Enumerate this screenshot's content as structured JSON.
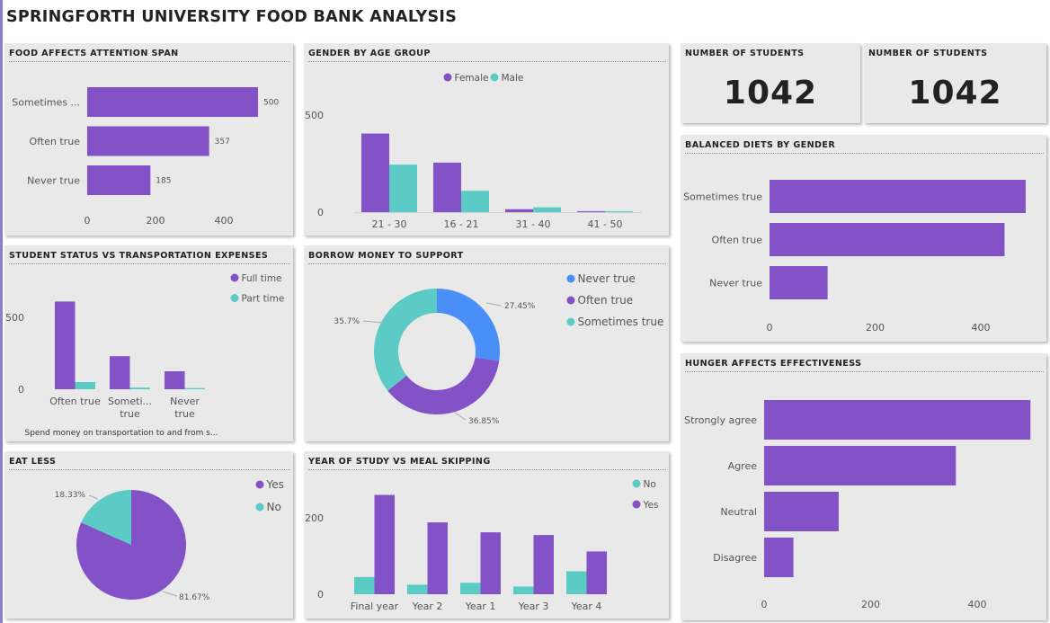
{
  "page": {
    "title": "SPRINGFORTH UNIVERSITY FOOD BANK ANALYSIS"
  },
  "colors": {
    "purple": "#8352c7",
    "teal": "#5ccbc6",
    "blue": "#4a8ef8",
    "text": "#555555",
    "panel": "#e9e9e9"
  },
  "kpis": [
    {
      "title": "NUMBER OF STUDENTS",
      "value": "1042"
    },
    {
      "title": "NUMBER OF STUDENTS",
      "value": "1042"
    }
  ],
  "chart_data": [
    {
      "id": "attention",
      "type": "bar",
      "orientation": "horizontal",
      "title": "FOOD AFFECTS ATTENTION SPAN",
      "categories": [
        "Sometimes ...",
        "Often true",
        "Never true"
      ],
      "values": [
        500,
        357,
        185
      ],
      "data_labels": [
        "500",
        "357",
        "185"
      ],
      "xticks": [
        "0",
        "200",
        "400"
      ],
      "xlim": [
        0,
        500
      ]
    },
    {
      "id": "gender",
      "type": "bar",
      "title": "GENDER BY AGE GROUP",
      "categories": [
        "21 - 30",
        "16 - 21",
        "31 - 40",
        "41 - 50"
      ],
      "series": [
        {
          "name": "Female",
          "values": [
            405,
            255,
            15,
            5
          ]
        },
        {
          "name": "Male",
          "values": [
            245,
            110,
            25,
            5
          ]
        }
      ],
      "yticks": [
        "0",
        "500"
      ],
      "ylim": [
        0,
        500
      ],
      "legend": "top-center"
    },
    {
      "id": "transport",
      "type": "bar",
      "title": "STUDENT STATUS VS TRANSPORTATION EXPENSES",
      "categories": [
        [
          "Often true"
        ],
        [
          "Someti...",
          "true"
        ],
        [
          "Never",
          "true"
        ]
      ],
      "series": [
        {
          "name": "Full time",
          "values": [
            610,
            230,
            125
          ]
        },
        {
          "name": "Part time",
          "values": [
            50,
            12,
            8
          ]
        }
      ],
      "yticks": [
        "0",
        "500"
      ],
      "ylim": [
        0,
        500
      ],
      "xlabel": "Spend money on transportation to and from s...",
      "legend": "top-right"
    },
    {
      "id": "borrow",
      "type": "pie",
      "title": "BORROW MONEY TO SUPPORT",
      "style": "donut",
      "slices": [
        {
          "name": "Never true",
          "value": 27.45,
          "label": "27.45%"
        },
        {
          "name": "Often true",
          "value": 36.85,
          "label": "36.85%"
        },
        {
          "name": "Sometimes true",
          "value": 35.7,
          "label": "35.7%"
        }
      ],
      "legend": "right"
    },
    {
      "id": "eatless",
      "type": "pie",
      "title": "EAT LESS",
      "slices": [
        {
          "name": "Yes",
          "value": 81.67,
          "label": "81.67%"
        },
        {
          "name": "No",
          "value": 18.33,
          "label": "18.33%"
        }
      ],
      "legend": "top-right"
    },
    {
      "id": "year",
      "type": "bar",
      "title": "YEAR OF STUDY VS MEAL SKIPPING",
      "categories": [
        "Final year",
        "Year 2",
        "Year 1",
        "Year 3",
        "Year 4"
      ],
      "series": [
        {
          "name": "No",
          "values": [
            45,
            25,
            30,
            20,
            60
          ]
        },
        {
          "name": "Yes",
          "values": [
            260,
            188,
            162,
            155,
            112
          ]
        }
      ],
      "yticks": [
        "0",
        "200"
      ],
      "ylim": [
        0,
        200
      ],
      "legend": "top-right"
    },
    {
      "id": "diets",
      "type": "bar",
      "orientation": "horizontal",
      "title": "BALANCED DIETS BY GENDER",
      "categories": [
        "Sometimes true",
        "Often true",
        "Never true"
      ],
      "values": [
        485,
        445,
        110
      ],
      "xticks": [
        "0",
        "200",
        "400"
      ],
      "xlim": [
        0,
        400
      ]
    },
    {
      "id": "hunger",
      "type": "bar",
      "orientation": "horizontal",
      "title": "HUNGER AFFECTS EFFECTIVENESS",
      "categories": [
        "Strongly agree",
        "Agree",
        "Neutral",
        "Disagree"
      ],
      "values": [
        500,
        360,
        140,
        55
      ],
      "xticks": [
        "0",
        "200",
        "400"
      ],
      "xlim": [
        0,
        400
      ]
    }
  ]
}
